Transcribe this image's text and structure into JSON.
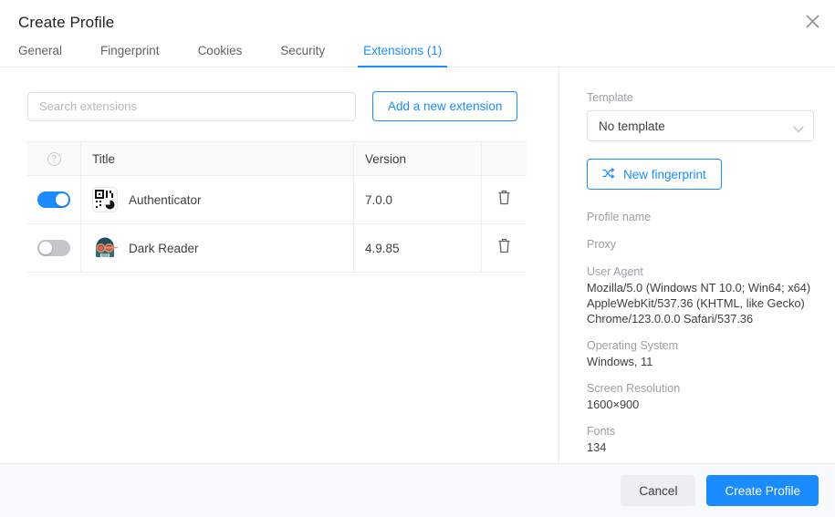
{
  "dialog": {
    "title": "Create Profile",
    "close_icon": "close-icon"
  },
  "tabs": [
    {
      "label": "General",
      "active": false
    },
    {
      "label": "Fingerprint",
      "active": false
    },
    {
      "label": "Cookies",
      "active": false
    },
    {
      "label": "Security",
      "active": false
    },
    {
      "label": "Extensions (1)",
      "active": true
    }
  ],
  "extensions_panel": {
    "search": {
      "value": "",
      "placeholder": "Search extensions"
    },
    "add_button": "Add a new extension",
    "table": {
      "headers": {
        "help_icon": "?",
        "title": "Title",
        "version": "Version",
        "actions": ""
      },
      "rows": [
        {
          "enabled": true,
          "icon": "qr-code-icon",
          "title": "Authenticator",
          "version": "7.0.0",
          "delete_icon": "trash-icon"
        },
        {
          "enabled": false,
          "icon": "dark-reader-icon",
          "title": "Dark Reader",
          "version": "4.9.85",
          "delete_icon": "trash-icon"
        }
      ]
    }
  },
  "side_panel": {
    "template_label": "Template",
    "template_value": "No template",
    "new_fingerprint_button": "New fingerprint",
    "summary": [
      {
        "label": "Profile name",
        "value": ""
      },
      {
        "label": "Proxy",
        "value": ""
      },
      {
        "label": "User Agent",
        "value": "Mozilla/5.0 (Windows NT 10.0; Win64; x64) AppleWebKit/537.36 (KHTML, like Gecko) Chrome/123.0.0.0 Safari/537.36"
      },
      {
        "label": "Operating System",
        "value": "Windows, 11"
      },
      {
        "label": "Screen Resolution",
        "value": "1600×900"
      },
      {
        "label": "Fonts",
        "value": "134"
      }
    ],
    "user_agent_lines": [
      "Mozilla/5.0 (Windows NT 10.0; Win64; x64)",
      "AppleWebKit/537.36 (KHTML, like Gecko)",
      "Chrome/123.0.0.0 Safari/537.36"
    ]
  },
  "footer": {
    "cancel": "Cancel",
    "create": "Create Profile"
  },
  "colors": {
    "accent": "#1a8cff",
    "muted_text": "#9aa0a6",
    "body_text": "#3c4043",
    "border": "#e6e8ea",
    "footer_bg": "#f8f9fa",
    "toggle_off": "#c3c7cb"
  }
}
